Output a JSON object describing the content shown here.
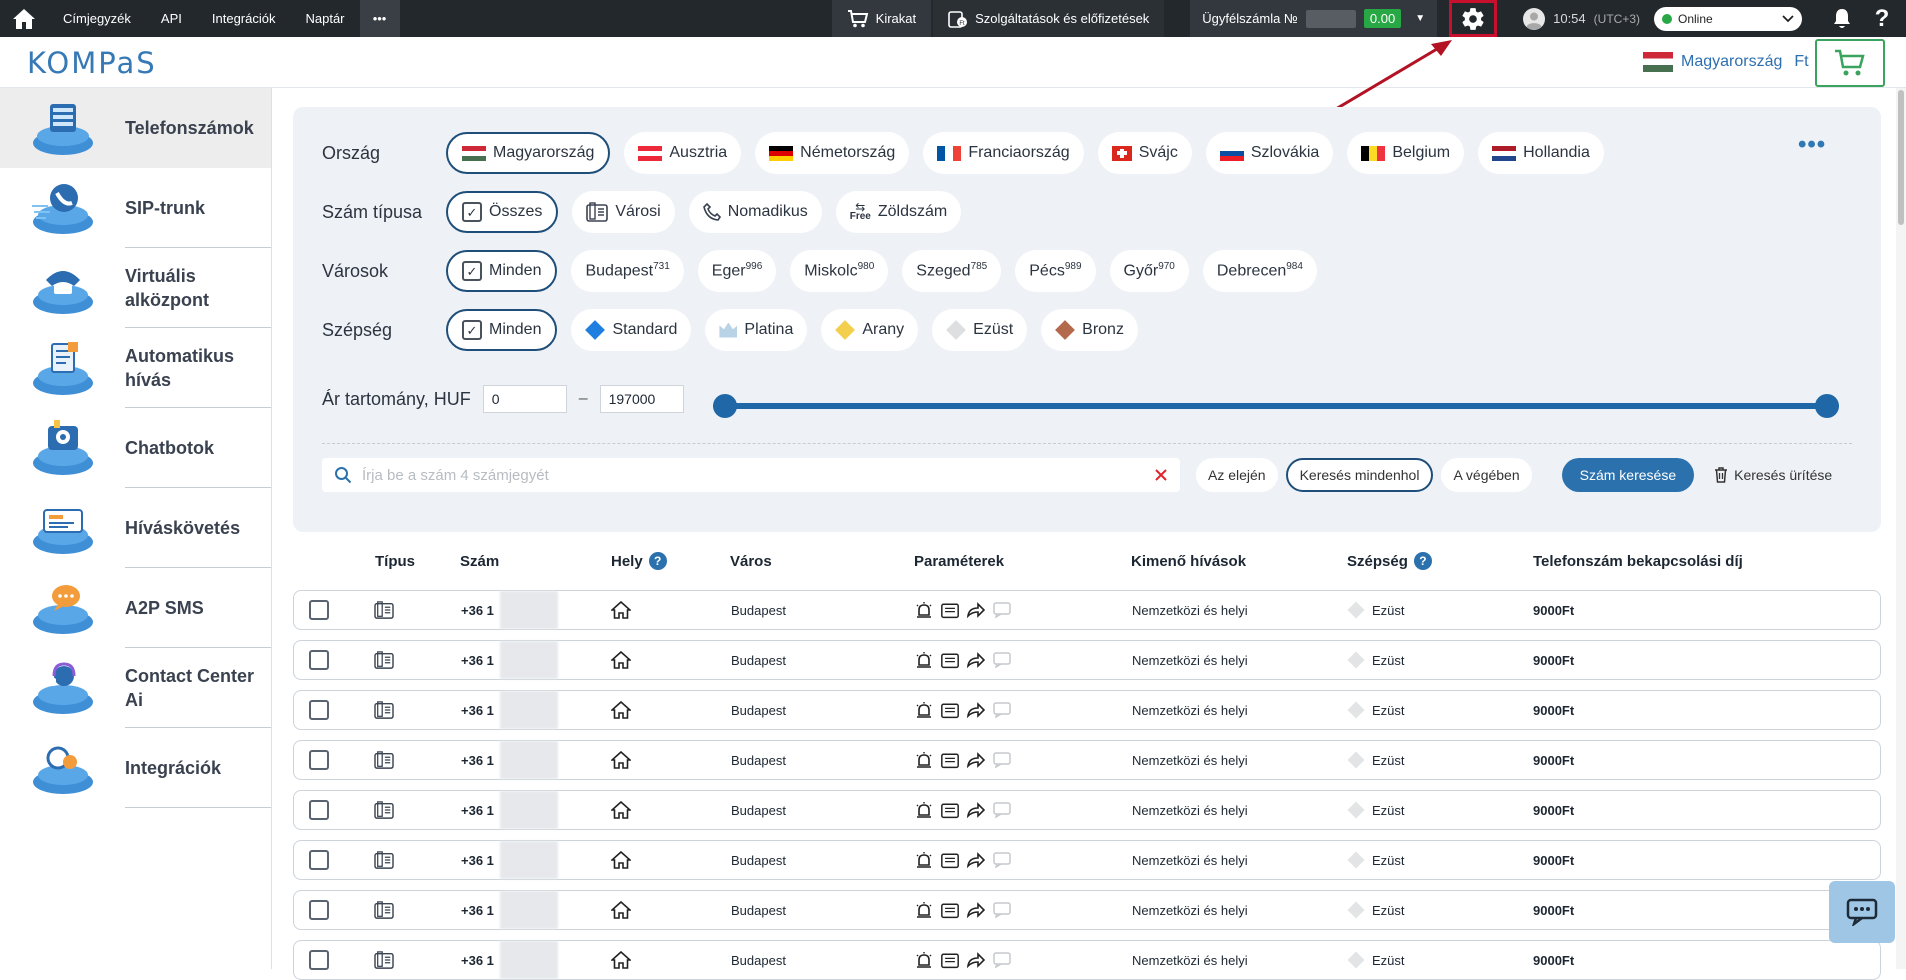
{
  "topbar": {
    "nav": [
      "Címjegyzék",
      "API",
      "Integrációk",
      "Naptár"
    ],
    "more_label": "•••",
    "showcase_label": "Kirakat",
    "services_label": "Szolgáltatások és előfizetések",
    "account_label": "Ügyfélszámla №",
    "balance": "0.00",
    "time": "10:54",
    "timezone": "(UTC+3)",
    "status": "Online",
    "help": "?"
  },
  "header": {
    "logo": "KOMPaS",
    "country": "Magyarország",
    "currency": "Ft"
  },
  "sidebar": {
    "items": [
      {
        "label": "Telefonszámok",
        "active": true
      },
      {
        "label": "SIP-trunk"
      },
      {
        "label": "Virtuális alközpont"
      },
      {
        "label": "Automatikus hívás"
      },
      {
        "label": "Chatbotok"
      },
      {
        "label": "Híváskövetés"
      },
      {
        "label": "A2P SMS"
      },
      {
        "label": "Contact Center Ai"
      },
      {
        "label": "Integrációk"
      }
    ]
  },
  "filters": {
    "country_label": "Ország",
    "countries": [
      "Magyarország",
      "Ausztria",
      "Németország",
      "Franciaország",
      "Svájc",
      "Szlovákia",
      "Belgium",
      "Hollandia"
    ],
    "type_label": "Szám típusa",
    "types": [
      "Összes",
      "Városi",
      "Nomadikus",
      "Zöldszám"
    ],
    "free_tag": "Free",
    "cities_label": "Városok",
    "cities": [
      {
        "name": "Minden",
        "count": ""
      },
      {
        "name": "Budapest",
        "count": "731"
      },
      {
        "name": "Eger",
        "count": "996"
      },
      {
        "name": "Miskolc",
        "count": "980"
      },
      {
        "name": "Szeged",
        "count": "785"
      },
      {
        "name": "Pécs",
        "count": "989"
      },
      {
        "name": "Győr",
        "count": "970"
      },
      {
        "name": "Debrecen",
        "count": "984"
      }
    ],
    "beauty_label": "Szépség",
    "beauty": [
      "Minden",
      "Standard",
      "Platina",
      "Arany",
      "Ezüst",
      "Bronz"
    ],
    "price_label": "Ár tartomány, HUF",
    "price_min": "0",
    "price_max": "197000",
    "search_placeholder": "Írja be a szám 4 számjegyét",
    "search_modes": [
      "Az elején",
      "Keresés mindenhol",
      "A végében"
    ],
    "search_button": "Szám keresése",
    "clear_button": "Keresés ürítése"
  },
  "table": {
    "headers": {
      "type": "Típus",
      "number": "Szám",
      "place": "Hely",
      "city": "Város",
      "params": "Paraméterek",
      "outgoing": "Kimenő hívások",
      "beauty": "Szépség",
      "fee": "Telefonszám bekapcsolási díj"
    },
    "rows": [
      {
        "number": "+36 1",
        "city": "Budapest",
        "outgoing": "Nemzetközi és helyi",
        "beauty": "Ezüst",
        "fee": "9000Ft"
      },
      {
        "number": "+36 1",
        "city": "Budapest",
        "outgoing": "Nemzetközi és helyi",
        "beauty": "Ezüst",
        "fee": "9000Ft"
      },
      {
        "number": "+36 1",
        "city": "Budapest",
        "outgoing": "Nemzetközi és helyi",
        "beauty": "Ezüst",
        "fee": "9000Ft"
      },
      {
        "number": "+36 1",
        "city": "Budapest",
        "outgoing": "Nemzetközi és helyi",
        "beauty": "Ezüst",
        "fee": "9000Ft"
      },
      {
        "number": "+36 1",
        "city": "Budapest",
        "outgoing": "Nemzetközi és helyi",
        "beauty": "Ezüst",
        "fee": "9000Ft"
      },
      {
        "number": "+36 1",
        "city": "Budapest",
        "outgoing": "Nemzetközi és helyi",
        "beauty": "Ezüst",
        "fee": "9000Ft"
      },
      {
        "number": "+36 1",
        "city": "Budapest",
        "outgoing": "Nemzetközi és helyi",
        "beauty": "Ezüst",
        "fee": "9000Ft"
      },
      {
        "number": "+36 1",
        "city": "Budapest",
        "outgoing": "Nemzetközi és helyi",
        "beauty": "Ezüst",
        "fee": "9000Ft"
      }
    ]
  },
  "colors": {
    "accent": "#2a71ad",
    "topbar": "#23282d",
    "highlight": "#c8102e",
    "balance_bg": "#28a745"
  }
}
